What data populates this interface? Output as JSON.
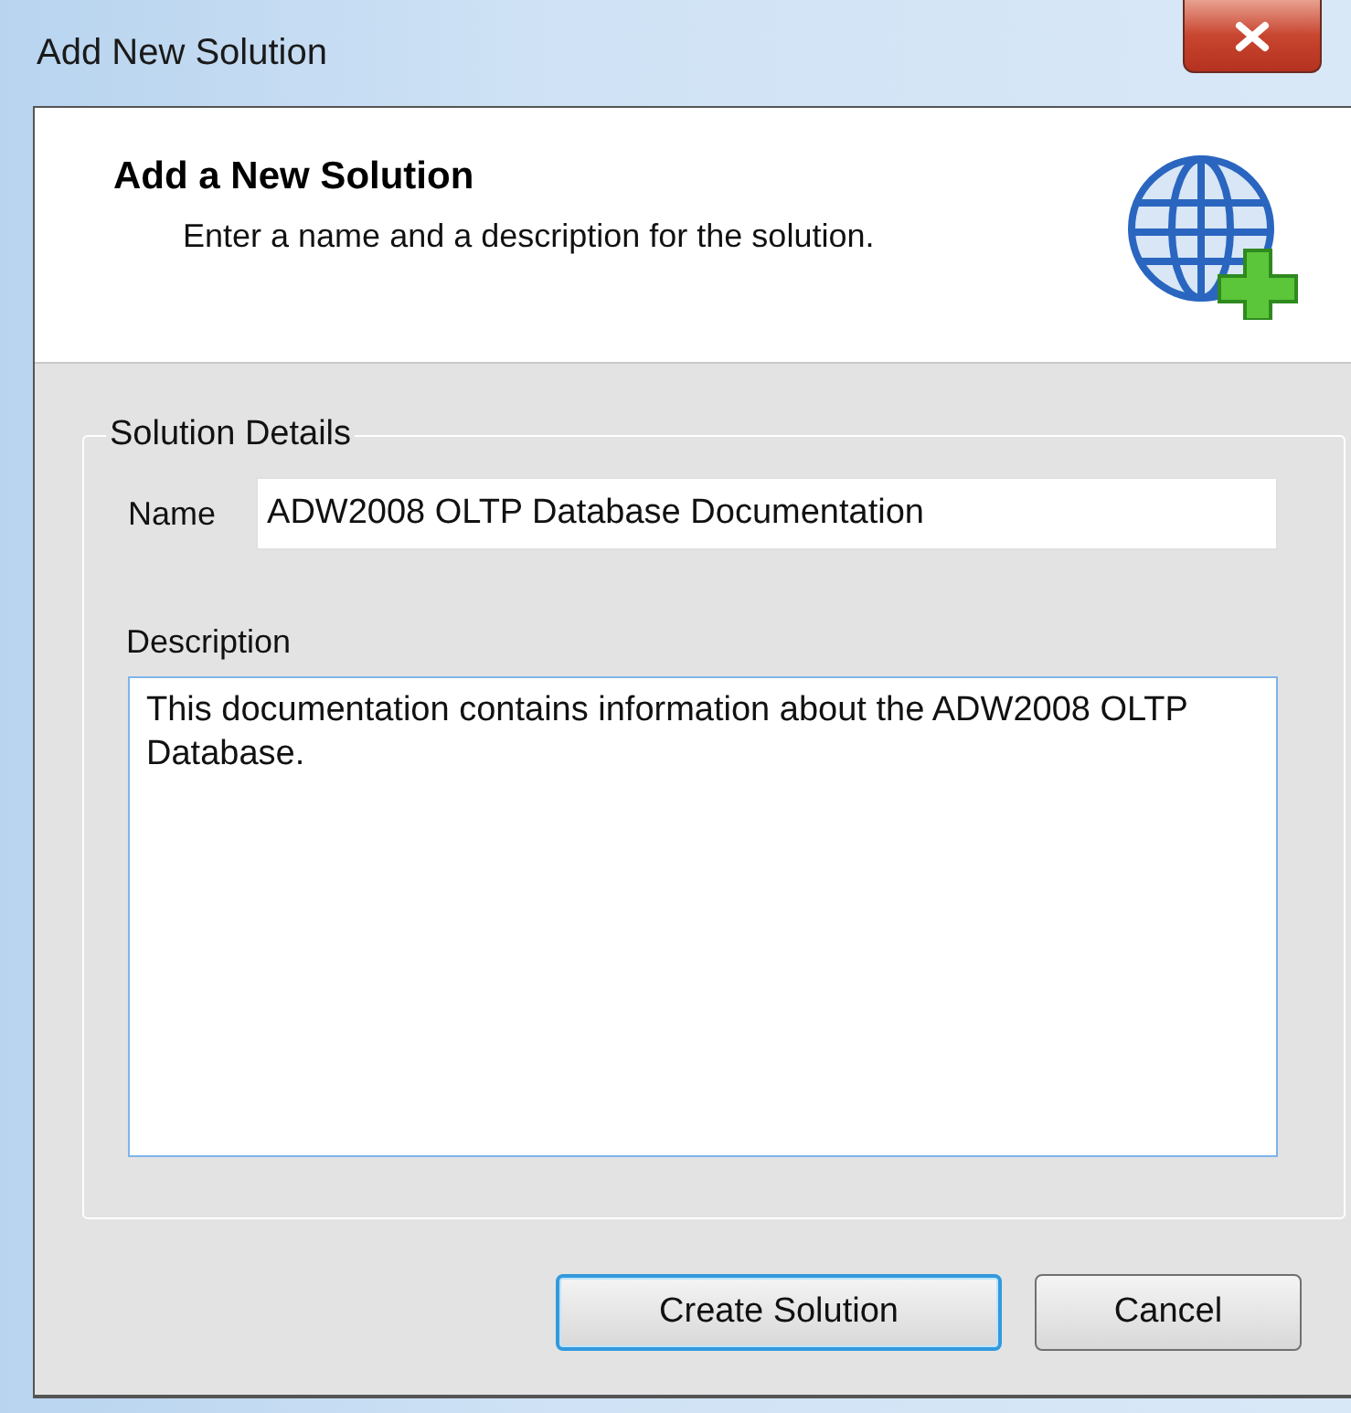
{
  "window": {
    "title": "Add New Solution"
  },
  "header": {
    "title": "Add a New Solution",
    "subtitle": "Enter a name and a description for the solution."
  },
  "group": {
    "legend": "Solution Details"
  },
  "fields": [
    {
      "kind": "line",
      "label": "Name",
      "value": "ADW2008 OLTP Database Documentation",
      "focused": false
    },
    {
      "kind": "multiline",
      "label": "Description",
      "value": "This documentation contains information about the ADW2008 OLTP Database.",
      "focused": true
    }
  ],
  "buttons": [
    {
      "label": "Create Solution",
      "default": true
    },
    {
      "label": "Cancel",
      "default": false
    }
  ]
}
